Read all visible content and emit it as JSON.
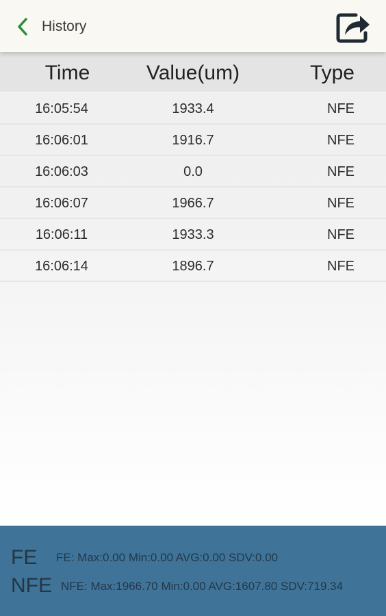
{
  "header": {
    "title": "History",
    "back_icon": "chevron-left-icon",
    "share_icon": "share-icon",
    "accent_color": "#2e8b3a"
  },
  "table": {
    "columns": [
      "Time",
      "Value(um)",
      "Type"
    ],
    "rows": [
      {
        "time": "16:05:54",
        "value": "1933.4",
        "type": "NFE"
      },
      {
        "time": "16:06:01",
        "value": "1916.7",
        "type": "NFE"
      },
      {
        "time": "16:06:03",
        "value": "0.0",
        "type": "NFE"
      },
      {
        "time": "16:06:07",
        "value": "1966.7",
        "type": "NFE"
      },
      {
        "time": "16:06:11",
        "value": "1933.3",
        "type": "NFE"
      },
      {
        "time": "16:06:14",
        "value": "1896.7",
        "type": "NFE"
      }
    ]
  },
  "stats": {
    "background_color": "#3f7398",
    "fe": {
      "label": "FE",
      "summary": "FE: Max:0.00 Min:0.00 AVG:0.00 SDV:0.00"
    },
    "nfe": {
      "label": "NFE",
      "summary": "NFE: Max:1966.70 Min:0.00 AVG:1607.80 SDV:719.34"
    }
  }
}
